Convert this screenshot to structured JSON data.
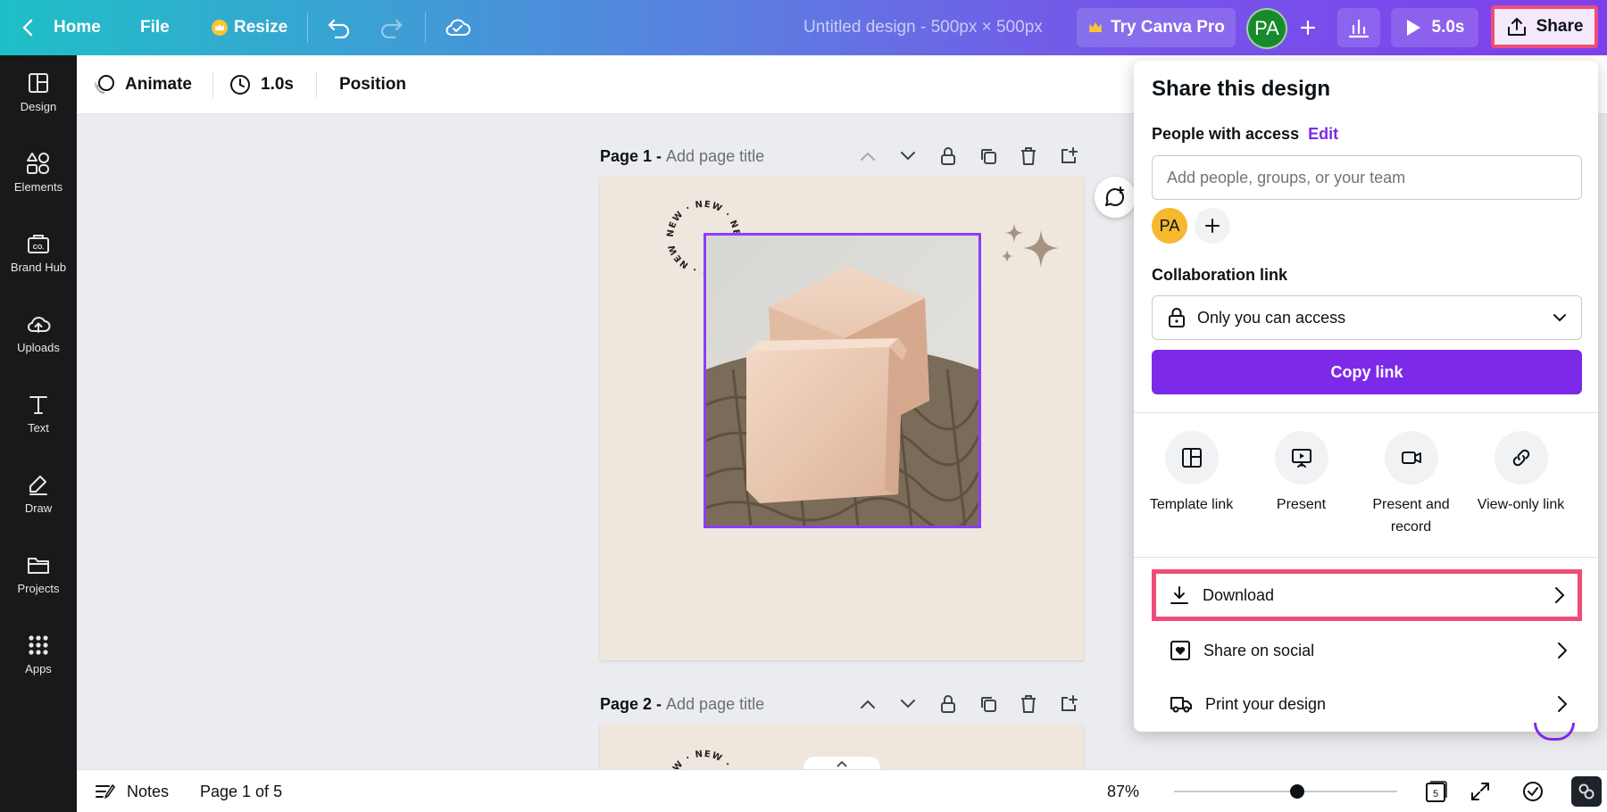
{
  "topbar": {
    "home": "Home",
    "file": "File",
    "resize": "Resize",
    "title": "Untitled design - 500px × 500px",
    "try_pro": "Try Canva Pro",
    "avatar": "PA",
    "timer": "5.0s",
    "share": "Share"
  },
  "sidebar": {
    "items": [
      {
        "label": "Design"
      },
      {
        "label": "Elements"
      },
      {
        "label": "Brand Hub"
      },
      {
        "label": "Uploads"
      },
      {
        "label": "Text"
      },
      {
        "label": "Draw"
      },
      {
        "label": "Projects"
      },
      {
        "label": "Apps"
      }
    ]
  },
  "toolbar": {
    "animate": "Animate",
    "duration": "1.0s",
    "position": "Position"
  },
  "canvas": {
    "page1": {
      "label": "Page 1 -",
      "placeholder": "Add page title"
    },
    "page2": {
      "label": "Page 2 -",
      "placeholder": "Add page title"
    },
    "badge_text": "NEW · NEW · NEW · NEW · NEW ·"
  },
  "bottombar": {
    "notes": "Notes",
    "page_indicator": "Page 1 of 5",
    "zoom": "87%",
    "zoom_fraction": 0.55,
    "page_count": "5"
  },
  "share_panel": {
    "title": "Share this design",
    "people_label": "People with access",
    "edit": "Edit",
    "input_placeholder": "Add people, groups, or your team",
    "avatar": "PA",
    "collab_label": "Collaboration link",
    "access_value": "Only you can access",
    "copy_link": "Copy link",
    "options": [
      {
        "label": "Template link"
      },
      {
        "label": "Present"
      },
      {
        "label": "Present and record"
      },
      {
        "label": "View-only link"
      }
    ],
    "rows": [
      {
        "label": "Download"
      },
      {
        "label": "Share on social"
      },
      {
        "label": "Print your design"
      }
    ]
  },
  "colors": {
    "accent": "#7d2ae8",
    "highlight": "#ee4d78",
    "page_bg": "#efe6de",
    "selection": "#8b3dff"
  }
}
